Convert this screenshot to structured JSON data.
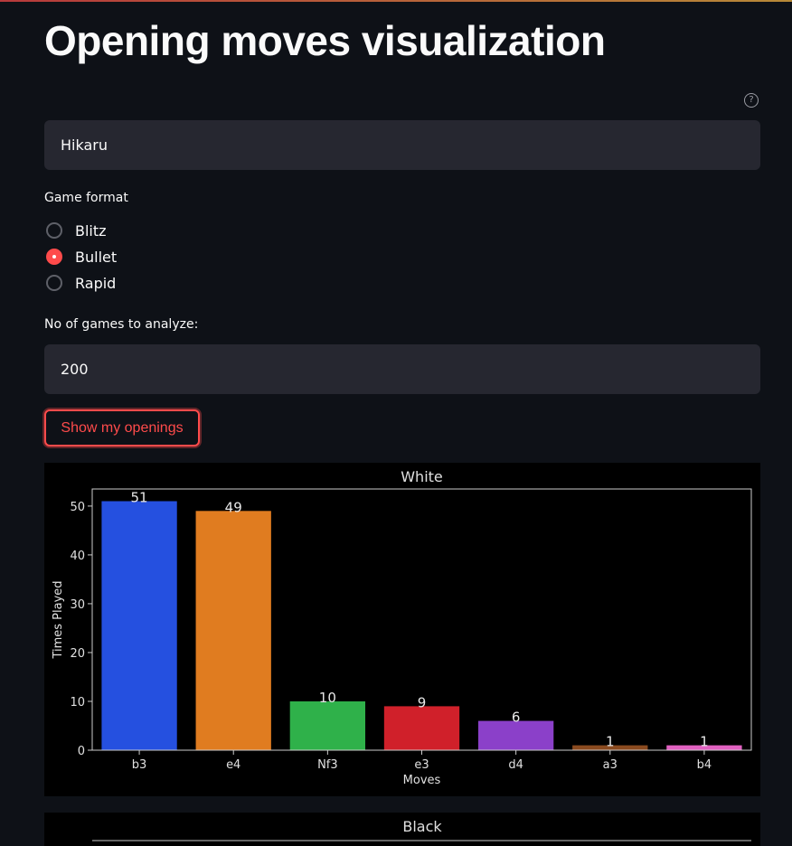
{
  "page": {
    "title": "Opening moves visualization",
    "help_icon": "question-circle-icon"
  },
  "username_input": {
    "value": "Hikaru"
  },
  "game_format": {
    "label": "Game format",
    "options": [
      {
        "label": "Blitz",
        "checked": false
      },
      {
        "label": "Bullet",
        "checked": true
      },
      {
        "label": "Rapid",
        "checked": false
      }
    ]
  },
  "games_input": {
    "label": "No of games to analyze:",
    "value": "200"
  },
  "show_button": {
    "label": "Show my openings"
  },
  "chart_data": [
    {
      "type": "bar",
      "title": "White",
      "xlabel": "Moves",
      "ylabel": "Times Played",
      "categories": [
        "b3",
        "e4",
        "Nf3",
        "e3",
        "d4",
        "a3",
        "b4"
      ],
      "values": [
        51,
        49,
        10,
        9,
        6,
        1,
        1
      ],
      "bar_colors": [
        "#2550e0",
        "#e07c20",
        "#2fb14a",
        "#d0202a",
        "#8b40c9",
        "#8a4a1f",
        "#e060c0"
      ],
      "yticks": [
        0,
        10,
        20,
        30,
        40,
        50
      ],
      "ylim": [
        0,
        53.5
      ],
      "grid": false,
      "background": "#000000"
    },
    {
      "type": "bar",
      "title": "Black"
    }
  ]
}
